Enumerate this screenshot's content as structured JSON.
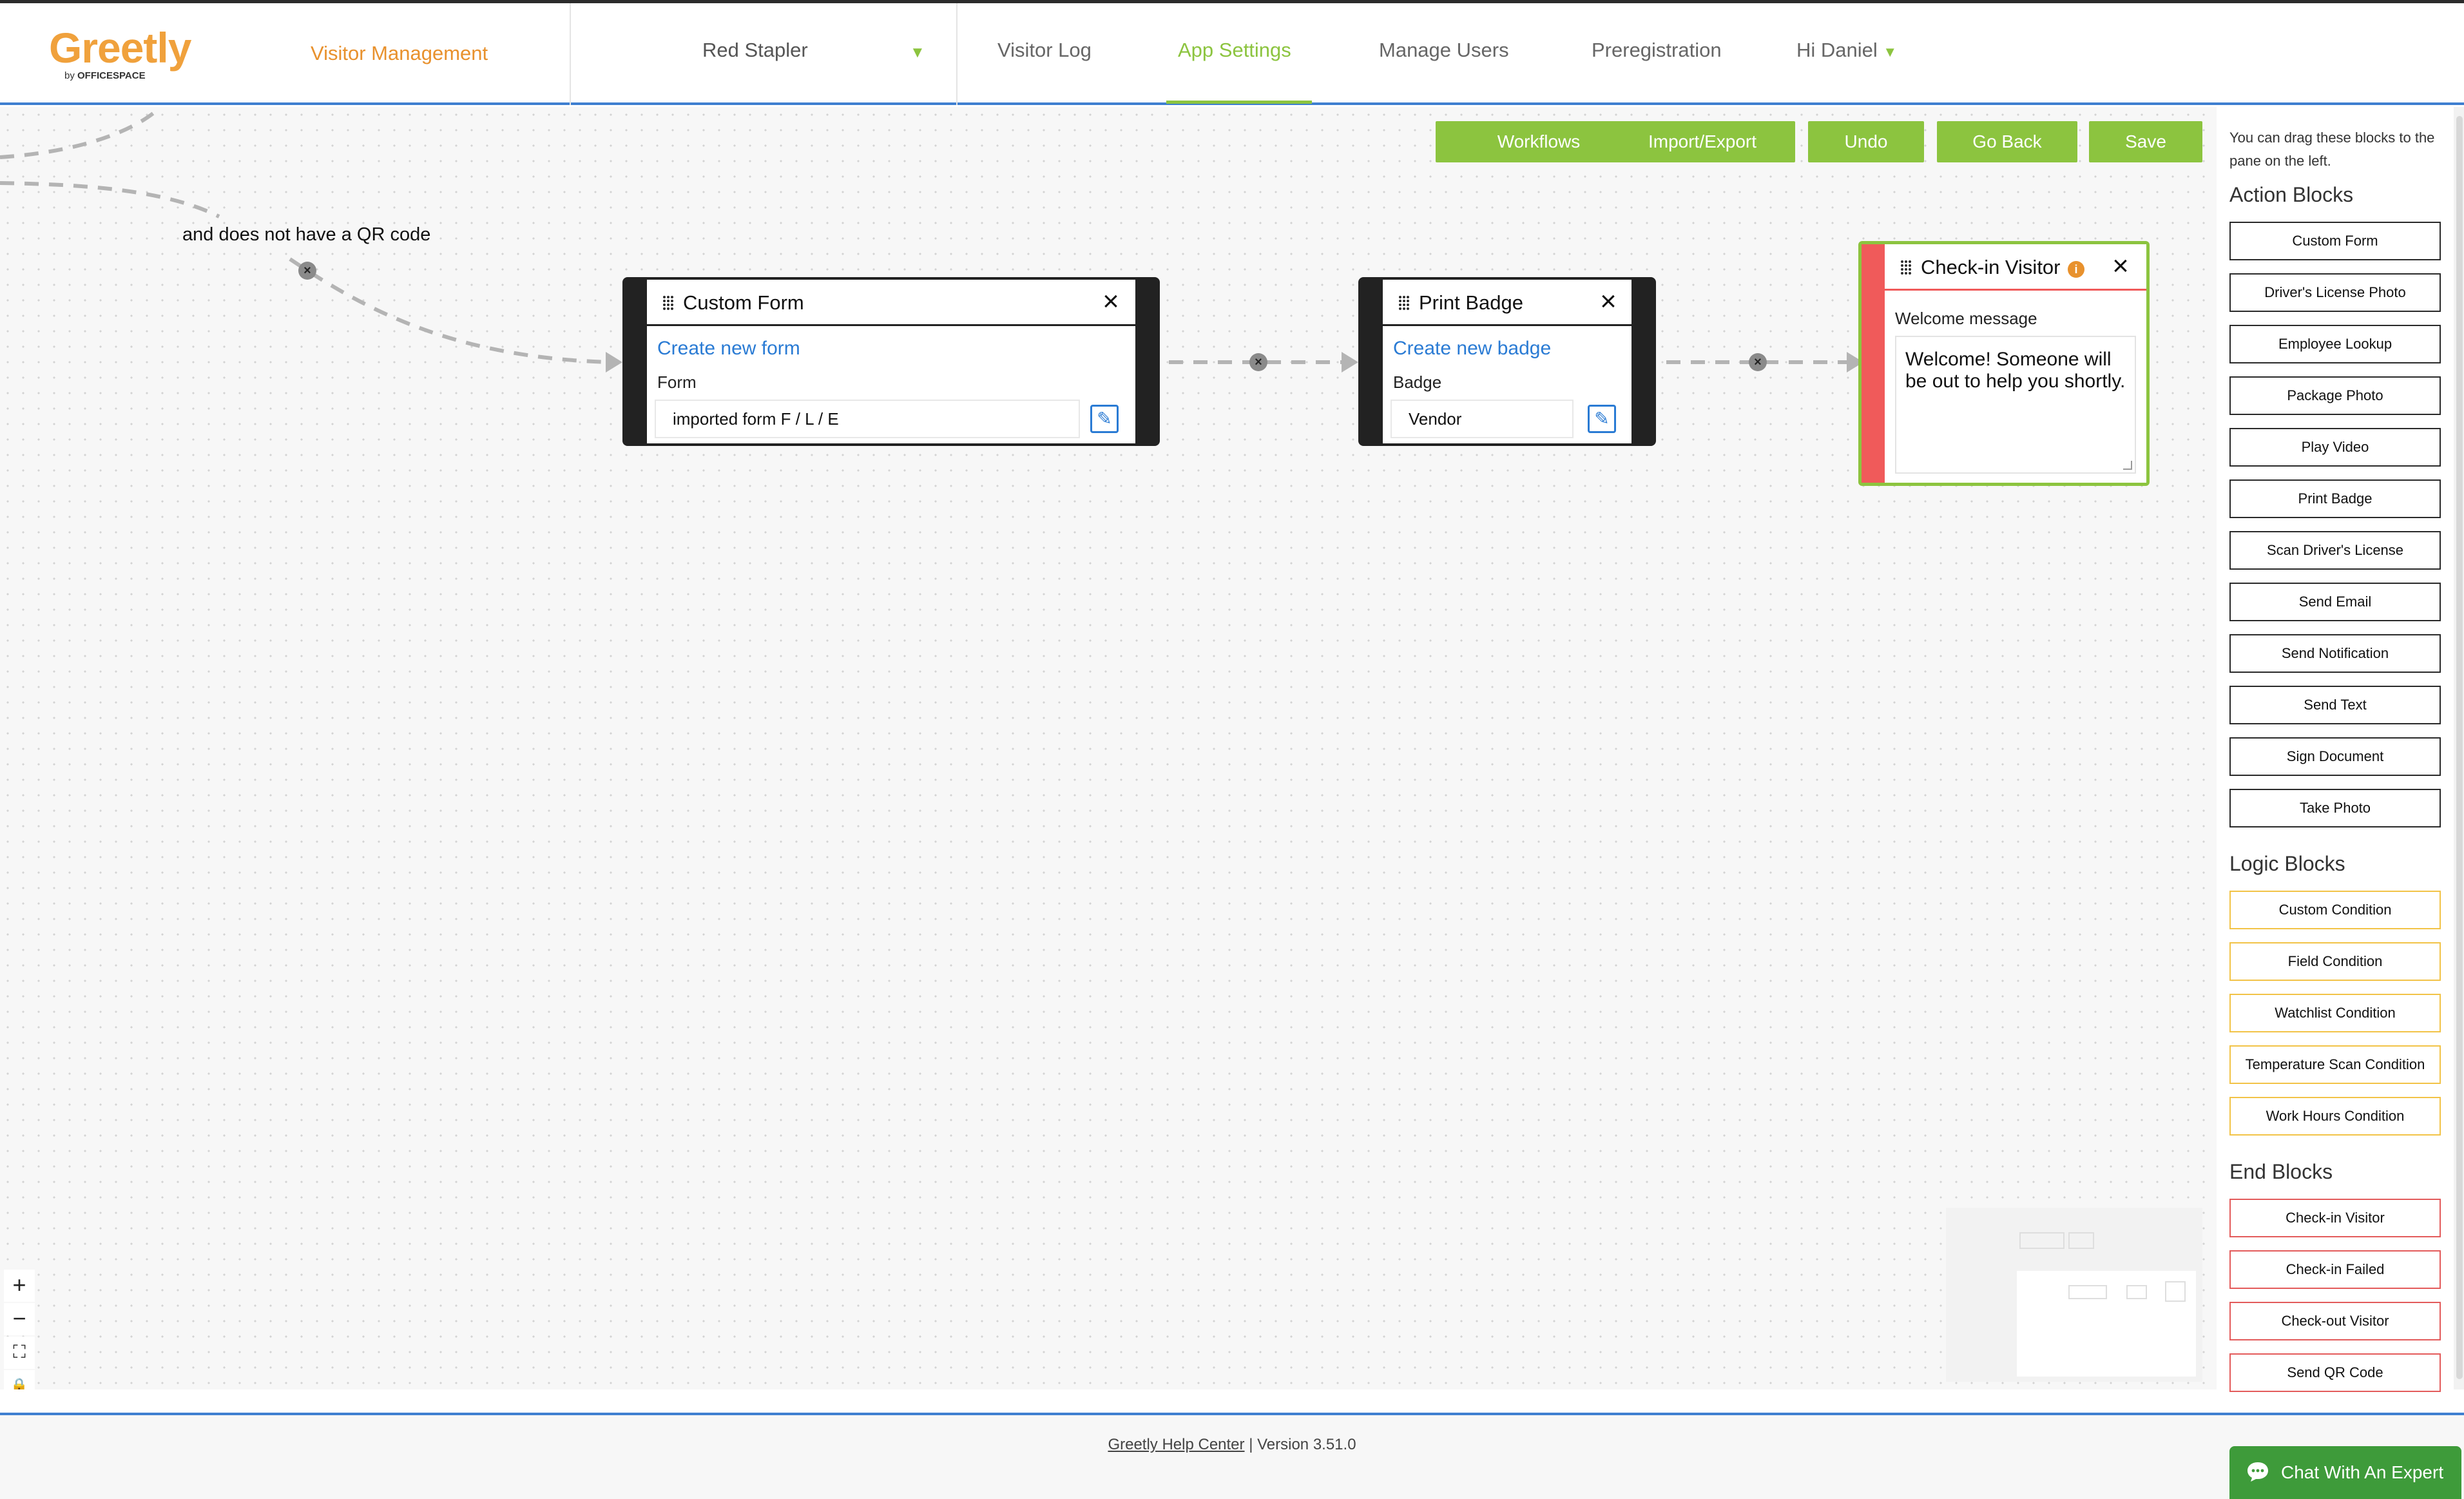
{
  "header": {
    "logo": {
      "word": "Greetly",
      "sub_prefix": "by ",
      "sub_brand": "OFFICESPACE"
    },
    "app_name": "Visitor Management",
    "location": "Red Stapler",
    "nav": [
      {
        "label": "Visitor Log",
        "active": false
      },
      {
        "label": "App Settings",
        "active": true
      },
      {
        "label": "Manage Users",
        "active": false
      },
      {
        "label": "Preregistration",
        "active": false
      }
    ],
    "user_greeting": "Hi Daniel",
    "accent_color": "#8cc43f",
    "brand_color": "#e8912d"
  },
  "toolbar": {
    "workflows": "Workflows",
    "import_export": "Import/Export",
    "undo": "Undo",
    "go_back": "Go Back",
    "save": "Save"
  },
  "canvas": {
    "edge_label": "and does not have a QR code",
    "delete_glyph": "×",
    "nodes": {
      "custom_form": {
        "title": "Custom Form",
        "link": "Create new form",
        "field_label": "Form",
        "field_value": "imported form F / L / E"
      },
      "print_badge": {
        "title": "Print Badge",
        "link": "Create new badge",
        "field_label": "Badge",
        "field_value": "Vendor"
      },
      "checkin_visitor": {
        "title": "Check-in Visitor",
        "field_label": "Welcome message",
        "message": "Welcome! Someone will be out to help you shortly."
      }
    },
    "zoom_controls": {
      "zoom_in": "+",
      "zoom_out": "−",
      "fit": "⛶",
      "lock": "🔒"
    }
  },
  "sidebar": {
    "hint": "You can drag these blocks to the pane on the left.",
    "action_heading": "Action Blocks",
    "action_blocks": [
      "Custom Form",
      "Driver's License Photo",
      "Employee Lookup",
      "Package Photo",
      "Play Video",
      "Print Badge",
      "Scan Driver's License",
      "Send Email",
      "Send Notification",
      "Send Text",
      "Sign Document",
      "Take Photo"
    ],
    "logic_heading": "Logic Blocks",
    "logic_blocks": [
      "Custom Condition",
      "Field Condition",
      "Watchlist Condition",
      "Temperature Scan Condition",
      "Work Hours Condition"
    ],
    "end_heading": "End Blocks",
    "end_blocks": [
      "Check-in Visitor",
      "Check-in Failed",
      "Check-out Visitor",
      "Send QR Code"
    ]
  },
  "footer": {
    "help_link": "Greetly Help Center",
    "version": " | Version 3.51.0",
    "chat": "Chat With An Expert"
  }
}
